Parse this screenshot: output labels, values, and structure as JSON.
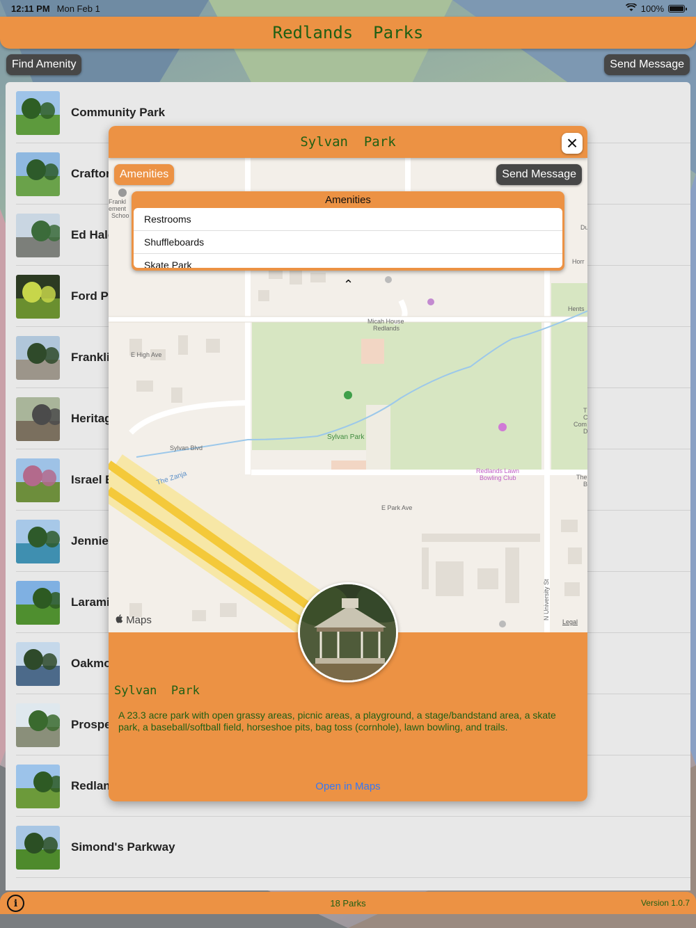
{
  "status": {
    "time": "12:11 PM",
    "date": "Mon Feb 1",
    "battery": "100%"
  },
  "header": {
    "title": "Redlands  Parks"
  },
  "toolbar": {
    "find_amenity": "Find Amenity",
    "send_message": "Send Message"
  },
  "parks": [
    {
      "name": "Community Park",
      "sky": "#9ec3e8",
      "ground": "#5d9a3d",
      "tree": "#2e5e24"
    },
    {
      "name": "Crafton",
      "sky": "#8fb8e0",
      "ground": "#6aa24a",
      "tree": "#2d5a2a"
    },
    {
      "name": "Ed Hale",
      "sky": "#c9d6e2",
      "ground": "#7c7f7a",
      "tree": "#3b6b3a"
    },
    {
      "name": "Ford Pa",
      "sky": "#2c3a22",
      "ground": "#6a8f2f",
      "tree": "#c7d64a"
    },
    {
      "name": "Franklin",
      "sky": "#b0c6da",
      "ground": "#9c958a",
      "tree": "#2f4a2a"
    },
    {
      "name": "Heritag",
      "sky": "#a9b59a",
      "ground": "#7a6f5e",
      "tree": "#4b4b4b"
    },
    {
      "name": "Israel B",
      "sky": "#9ec2e6",
      "ground": "#6d8e3c",
      "tree": "#b36a8c"
    },
    {
      "name": "Jennie",
      "sky": "#a7c8e8",
      "ground": "#3f8fb0",
      "tree": "#2e5a2a"
    },
    {
      "name": "Laramie",
      "sky": "#7fb0e2",
      "ground": "#4f8f2f",
      "tree": "#2d5a22"
    },
    {
      "name": "Oakmor",
      "sky": "#c5d8ea",
      "ground": "#4c6a8a",
      "tree": "#2e4a2a"
    },
    {
      "name": "Prospec",
      "sky": "#dfe8ee",
      "ground": "#8a8f7a",
      "tree": "#3a6a2e"
    },
    {
      "name": "Redlanc",
      "sky": "#9cc3ea",
      "ground": "#6c9a3a",
      "tree": "#2e5a24"
    },
    {
      "name": "Simond's Parkway",
      "sky": "#a8c6e4",
      "ground": "#4e8a2c",
      "tree": "#2b4f24"
    }
  ],
  "footer": {
    "count": "18 Parks",
    "version": "Version 1.0.7",
    "info_icon": "i"
  },
  "modal": {
    "title": "Sylvan  Park",
    "close_icon": "×",
    "amenities_button": "Amenities",
    "send_message": "Send Message",
    "dropdown_title": "Amenities",
    "amenities": [
      "Restrooms",
      "Shuffleboards",
      "Skate Park"
    ],
    "chevron": "⌃",
    "maps_logo": "Maps",
    "legal": "Legal",
    "map_labels": {
      "school": "Frankl\nement\nSchoo",
      "micah": "Micah House\nRedlands",
      "high": "E High Ave",
      "sylvan_blvd": "Sylvan Blvd",
      "zanja": "The Zanja",
      "sylvan_park": "Sylvan Park",
      "lawn": "Redlands Lawn\nBowling Club",
      "park_ave": "E Park Ave",
      "university": "N University St",
      "du": "Du",
      "horr": "Horr",
      "hents": "Hents",
      "com": "T\nC\nCom\nD",
      "the": "The\nB"
    },
    "park_name": "Sylvan  Park",
    "description": "A 23.3 acre park with open grassy areas, picnic areas, a playground, a stage/bandstand area, a skate park, a baseball/softball field, horseshoe pits, bag toss (cornhole), lawn bowling, and trails.",
    "open_maps": "Open in Maps"
  }
}
